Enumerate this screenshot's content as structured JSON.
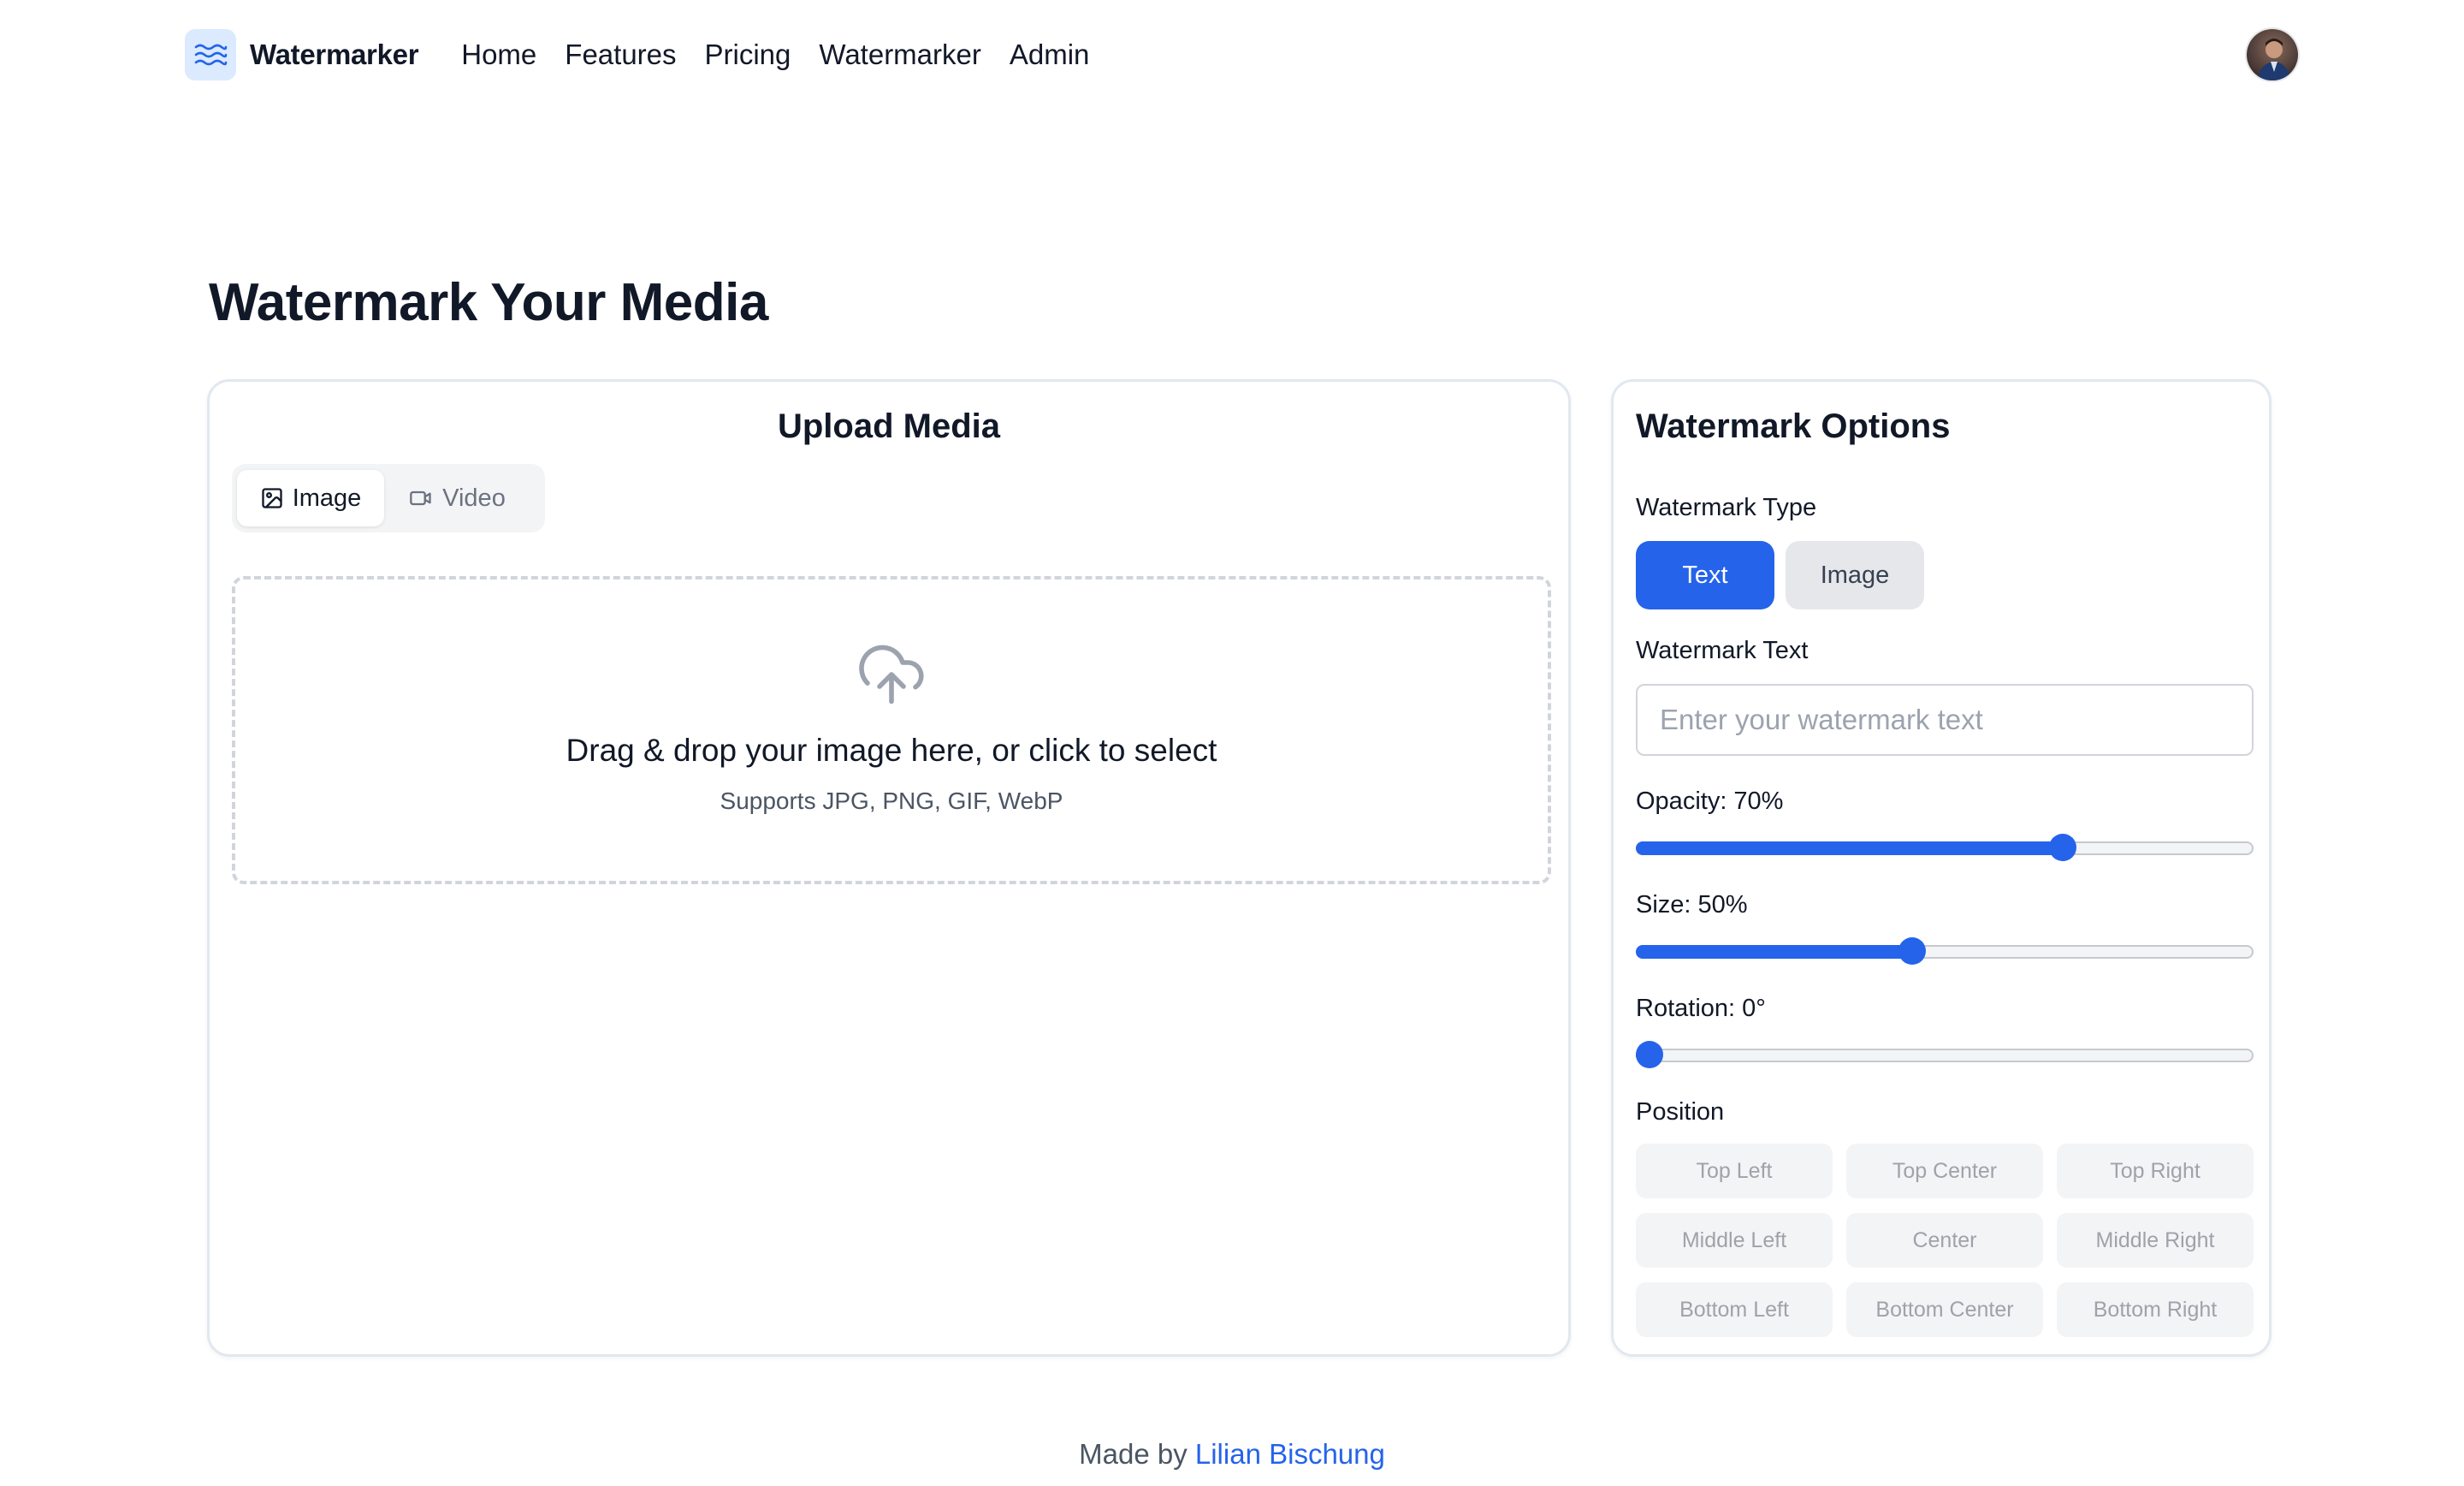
{
  "nav": {
    "brand": "Watermarker",
    "links": [
      "Home",
      "Features",
      "Pricing",
      "Watermarker",
      "Admin"
    ]
  },
  "page": {
    "title": "Watermark Your Media"
  },
  "upload": {
    "title": "Upload Media",
    "tabs": [
      "Image",
      "Video"
    ],
    "active_tab": "Image",
    "dropzone_title": "Drag & drop your image here, or click to select",
    "dropzone_sub": "Supports JPG, PNG, GIF, WebP"
  },
  "options": {
    "title": "Watermark Options",
    "type_label": "Watermark Type",
    "type_options": [
      "Text",
      "Image"
    ],
    "type_selected": "Text",
    "text_label": "Watermark Text",
    "text_placeholder": "Enter your watermark text",
    "text_value": "",
    "opacity_label": "Opacity: 70%",
    "opacity_value": 70,
    "size_label": "Size: 50%",
    "size_value": 50,
    "rotation_label": "Rotation: 0°",
    "rotation_value": 0,
    "position_label": "Position",
    "positions": [
      "Top Left",
      "Top Center",
      "Top Right",
      "Middle Left",
      "Center",
      "Middle Right",
      "Bottom Left",
      "Bottom Center",
      "Bottom Right"
    ]
  },
  "footer": {
    "prefix": "Made by ",
    "author": "Lilian Bischung"
  },
  "colors": {
    "accent": "#2563eb",
    "logo_bg": "#dbeafe",
    "border": "#e2e8f0",
    "muted_button": "#f3f4f6"
  },
  "icons": {
    "logo": "waves-icon",
    "image_tab": "image-icon",
    "video_tab": "video-camera-icon",
    "dropzone": "cloud-upload-icon"
  }
}
